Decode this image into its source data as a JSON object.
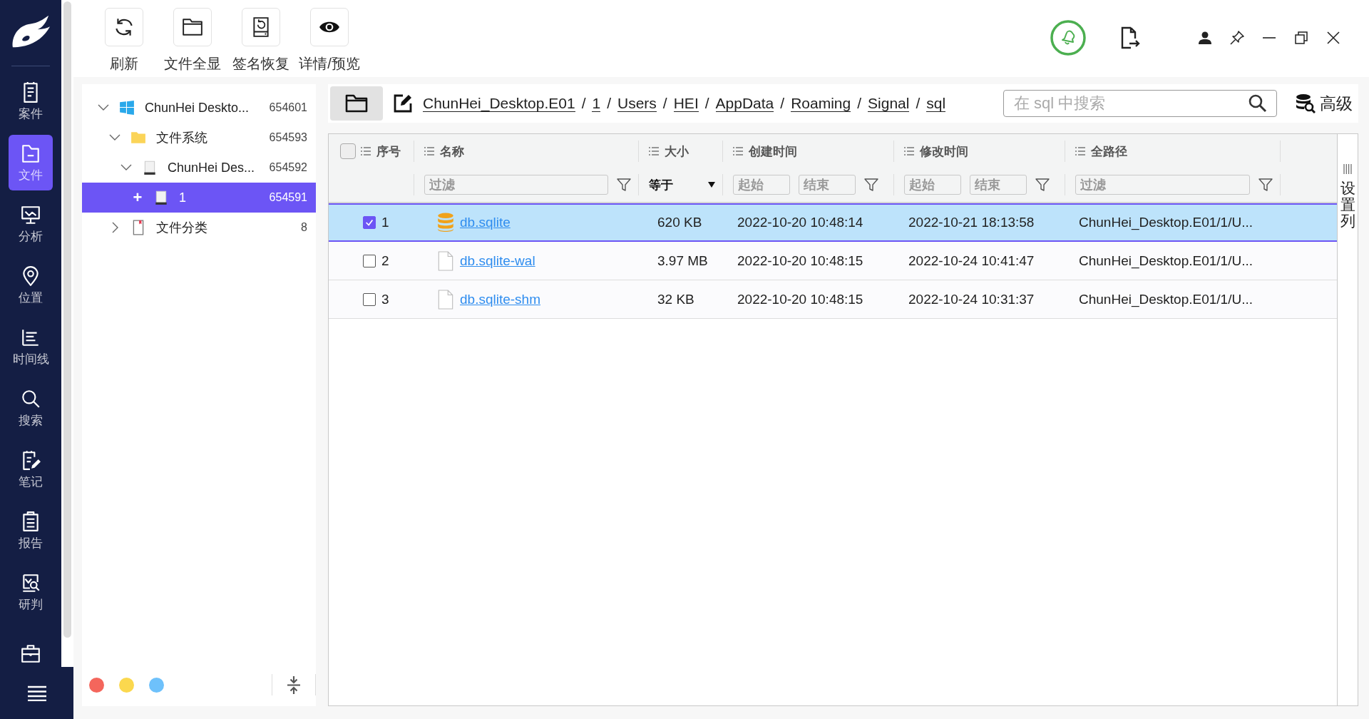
{
  "nav": {
    "items": [
      {
        "kind": "case",
        "label": "案件",
        "selected": false
      },
      {
        "kind": "file",
        "label": "文件",
        "selected": true
      },
      {
        "kind": "analysis",
        "label": "分析",
        "selected": false
      },
      {
        "kind": "location",
        "label": "位置",
        "selected": false
      },
      {
        "kind": "timeline",
        "label": "时间线",
        "selected": false
      },
      {
        "kind": "search",
        "label": "搜索",
        "selected": false
      },
      {
        "kind": "notes",
        "label": "笔记",
        "selected": false
      },
      {
        "kind": "report",
        "label": "报告",
        "selected": false
      },
      {
        "kind": "judge",
        "label": "研判",
        "selected": false
      },
      {
        "kind": "toolbox",
        "selected": false
      }
    ]
  },
  "toolbar": {
    "buttons": [
      {
        "kind": "refresh",
        "label": "刷新"
      },
      {
        "kind": "folder",
        "label": "文件全显"
      },
      {
        "kind": "restore",
        "label": "签名恢复"
      },
      {
        "kind": "eye",
        "label": "详情/预览"
      }
    ]
  },
  "tree": {
    "nodes": [
      {
        "kind": "windows",
        "label": "ChunHei Deskto...",
        "count": "654601",
        "expanded": true,
        "selected": false,
        "children": [
          {
            "kind": "folder",
            "label": "文件系统",
            "count": "654593",
            "expanded": true,
            "selected": false,
            "children": [
              {
                "kind": "drive",
                "label": "ChunHei Des...",
                "count": "654592",
                "expanded": true,
                "selected": false,
                "children": [
                  {
                    "kind": "drive",
                    "marker": "+",
                    "label": "1",
                    "count": "654591",
                    "selected": true
                  }
                ]
              }
            ]
          },
          {
            "kind": "category",
            "label": "文件分类",
            "count": "8",
            "expanded": false,
            "selected": false
          }
        ]
      }
    ]
  },
  "color_tags": [
    {
      "color": "#f4665c"
    },
    {
      "color": "#fbd84e"
    },
    {
      "color": "#6ec1fb"
    }
  ],
  "breadcrumb": [
    {
      "kind": "segment",
      "text": "ChunHei_Desktop.E01"
    },
    {
      "kind": "separator",
      "text": "/"
    },
    {
      "kind": "segment",
      "text": "1"
    },
    {
      "kind": "separator",
      "text": "/"
    },
    {
      "kind": "segment",
      "text": "Users"
    },
    {
      "kind": "separator",
      "text": "/"
    },
    {
      "kind": "segment",
      "text": "HEI"
    },
    {
      "kind": "separator",
      "text": "/"
    },
    {
      "kind": "segment",
      "text": "AppData"
    },
    {
      "kind": "separator",
      "text": "/"
    },
    {
      "kind": "segment",
      "text": "Roaming"
    },
    {
      "kind": "separator",
      "text": "/"
    },
    {
      "kind": "segment",
      "text": "Signal"
    },
    {
      "kind": "separator",
      "text": "/"
    },
    {
      "kind": "segment",
      "text": "sql"
    }
  ],
  "search": {
    "placeholder": "在 sql 中搜索"
  },
  "advanced": {
    "label": "高级"
  },
  "table": {
    "select_all": {
      "checked": false
    },
    "columns": [
      {
        "label": "序号",
        "filter": {
          "kind": "none"
        }
      },
      {
        "label": "名称",
        "filter": {
          "kind": "text",
          "placeholder": "过滤"
        }
      },
      {
        "label": "大小",
        "filter": {
          "kind": "select",
          "value": "等于"
        }
      },
      {
        "label": "创建时间",
        "filter": {
          "kind": "range",
          "placeholders": [
            "起始",
            "结束"
          ]
        }
      },
      {
        "label": "修改时间",
        "filter": {
          "kind": "range",
          "placeholders": [
            "起始",
            "结束"
          ]
        }
      },
      {
        "label": "全路径",
        "filter": {
          "kind": "text",
          "placeholder": "过滤"
        }
      }
    ],
    "rows": [
      {
        "index": "1",
        "name": "db.sqlite",
        "kind": "database",
        "size": "620 KB",
        "created": "2022-10-20 10:48:14",
        "modified": "2022-10-21 18:13:58",
        "path": "ChunHei_Desktop.E01/1/U...",
        "checked": true,
        "selected": true
      },
      {
        "index": "2",
        "name": "db.sqlite-wal",
        "kind": "file",
        "size": "3.97 MB",
        "created": "2022-10-20 10:48:15",
        "modified": "2022-10-24 10:41:47",
        "path": "ChunHei_Desktop.E01/1/U...",
        "checked": false,
        "selected": false
      },
      {
        "index": "3",
        "name": "db.sqlite-shm",
        "kind": "file",
        "size": "32 KB",
        "created": "2022-10-20 10:48:15",
        "modified": "2022-10-24 10:31:37",
        "path": "ChunHei_Desktop.E01/1/U...",
        "checked": false,
        "selected": false
      }
    ]
  },
  "column_settings": {
    "label": "设置列"
  }
}
